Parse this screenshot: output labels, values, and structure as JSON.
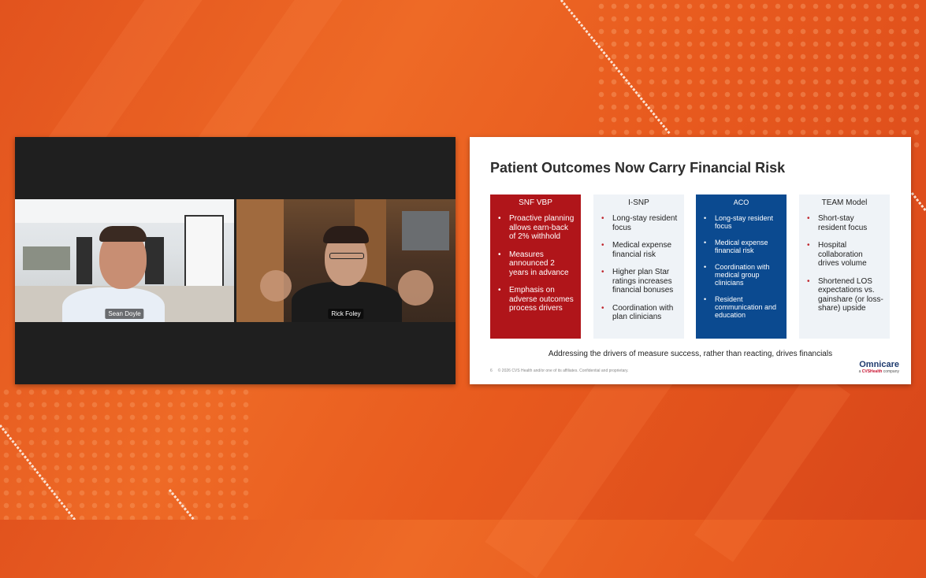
{
  "participants": [
    {
      "name": "Sean Doyle"
    },
    {
      "name": "Rick Foley"
    }
  ],
  "slide": {
    "title": "Patient Outcomes Now Carry Financial Risk",
    "columns": [
      {
        "header": "SNF VBP",
        "style": "red",
        "items": [
          "Proactive planning allows earn-back of 2% withhold",
          "Measures announced 2 years in advance",
          "Emphasis on adverse outcomes process drivers"
        ]
      },
      {
        "header": "I-SNP",
        "style": "light",
        "items": [
          "Long-stay resident focus",
          "Medical expense financial risk",
          "Higher plan Star ratings increases financial bonuses",
          "Coordination with plan clinicians"
        ]
      },
      {
        "header": "ACO",
        "style": "blue",
        "items": [
          "Long-stay resident focus",
          "Medical expense financial risk",
          "Coordination with medical group clinicians",
          "Resident communication and education"
        ]
      },
      {
        "header": "TEAM Model",
        "style": "light",
        "items": [
          "Short-stay resident focus",
          "Hospital collaboration drives volume",
          "Shortened LOS expectations vs. gainshare (or loss-share) upside"
        ]
      }
    ],
    "tagline": "Addressing the drivers of measure success, rather than reacting, drives financials",
    "page_number": "6",
    "footer": "© 2026 CVS Health and/or one of its affiliates. Confidential and proprietary.",
    "brand": {
      "name": "Omnicare",
      "sub_prefix": "a",
      "sub_brand": "CVSHealth",
      "sub_suffix": "company"
    }
  },
  "colors": {
    "background": "#e8581f",
    "red_card": "#b0151a",
    "blue_card": "#0b4a90",
    "light_card": "#eff3f7"
  }
}
